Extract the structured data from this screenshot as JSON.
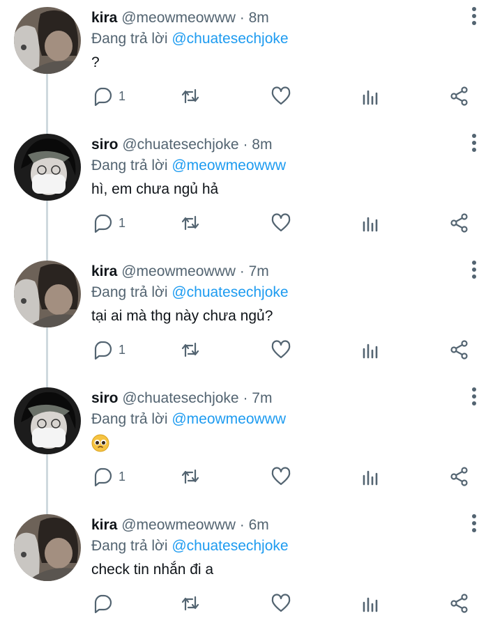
{
  "reply_prefix": "Đang trả lời",
  "tweets": [
    {
      "name": "kira",
      "handle": "@meowmeowww",
      "time": "· 8m",
      "reply_to": "@chuatesechjoke",
      "text": "?",
      "reply_count": "1",
      "avatar": "cat"
    },
    {
      "name": "siro",
      "handle": "@chuatesechjoke",
      "time": "· 8m",
      "reply_to": "@meowmeowww",
      "text": "hì, em chưa ngủ hả",
      "reply_count": "1",
      "avatar": "mask"
    },
    {
      "name": "kira",
      "handle": "@meowmeowww",
      "time": "· 7m",
      "reply_to": "@chuatesechjoke",
      "text": "tại ai mà thg này chưa ngủ?",
      "reply_count": "1",
      "avatar": "cat"
    },
    {
      "name": "siro",
      "handle": "@chuatesechjoke",
      "time": "· 7m",
      "reply_to": "@meowmeowww",
      "text": "",
      "emoji": "pleading-face-emoji",
      "reply_count": "1",
      "avatar": "mask"
    },
    {
      "name": "kira",
      "handle": "@meowmeowww",
      "time": "· 6m",
      "reply_to": "@chuatesechjoke",
      "text": "check tin nhắn đi a",
      "reply_count": "",
      "avatar": "cat"
    }
  ],
  "icons": {
    "reply": "reply-icon",
    "retweet": "retweet-icon",
    "like": "like-icon",
    "analytics": "analytics-icon",
    "share": "share-icon",
    "more": "more-vertical-icon"
  },
  "colors": {
    "mention": "#1d9bf0",
    "secondary_text": "#536471",
    "icon": "#536471",
    "thread_line": "#cfd9de"
  }
}
